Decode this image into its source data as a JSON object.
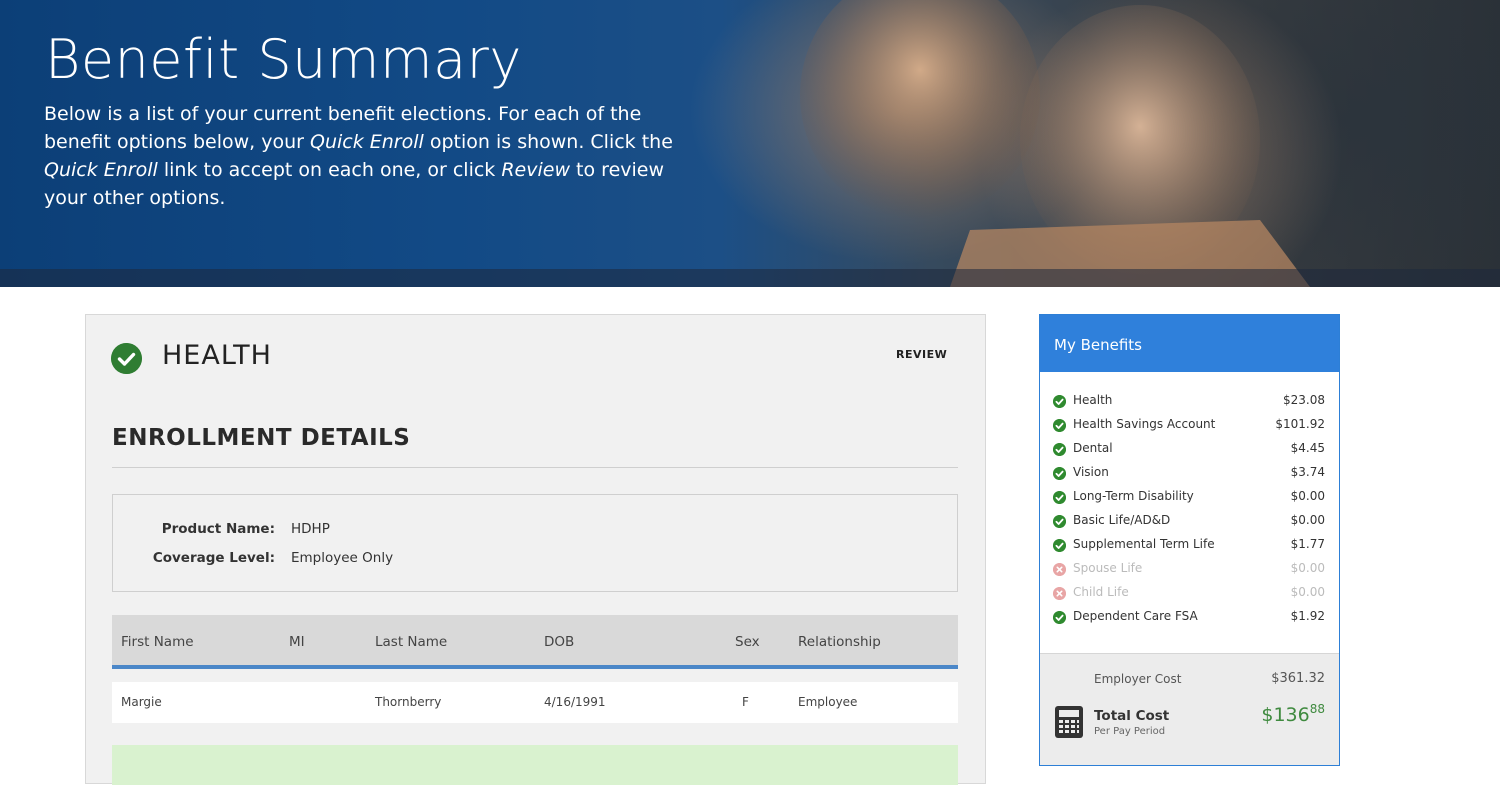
{
  "hero": {
    "title": "Benefit Summary",
    "desc_1": "Below is a list of your current benefit elections. For each of the benefit options below, your ",
    "desc_quick_1": "Quick Enroll",
    "desc_2": " option is shown. Click the ",
    "desc_quick_2": "Quick Enroll",
    "desc_3": " link to accept on each one, or click ",
    "desc_review": "Review",
    "desc_4": " to review your other options."
  },
  "card": {
    "section_title": "HEALTH",
    "review_label": "REVIEW",
    "enroll_title": "ENROLLMENT DETAILS",
    "product_label": "Product Name:",
    "product_value": "HDHP",
    "coverage_label": "Coverage Level:",
    "coverage_value": "Employee Only",
    "columns": [
      "First Name",
      "MI",
      "Last Name",
      "DOB",
      "Sex",
      "Relationship"
    ],
    "rows": [
      {
        "first": "Margie",
        "mi": "",
        "last": "Thornberry",
        "dob": "4/16/1991",
        "sex": "F",
        "rel": "Employee"
      }
    ]
  },
  "sidebar": {
    "title": "My Benefits",
    "items": [
      {
        "name": "Health",
        "amount": "$23.08",
        "status": "enrolled"
      },
      {
        "name": "Health Savings Account",
        "amount": "$101.92",
        "status": "enrolled"
      },
      {
        "name": "Dental",
        "amount": "$4.45",
        "status": "enrolled"
      },
      {
        "name": "Vision",
        "amount": "$3.74",
        "status": "enrolled"
      },
      {
        "name": "Long-Term Disability",
        "amount": "$0.00",
        "status": "enrolled"
      },
      {
        "name": "Basic Life/AD&D",
        "amount": "$0.00",
        "status": "enrolled"
      },
      {
        "name": "Supplemental Term Life",
        "amount": "$1.77",
        "status": "enrolled"
      },
      {
        "name": "Spouse Life",
        "amount": "$0.00",
        "status": "waived"
      },
      {
        "name": "Child Life",
        "amount": "$0.00",
        "status": "waived"
      },
      {
        "name": "Dependent Care FSA",
        "amount": "$1.92",
        "status": "enrolled"
      }
    ],
    "employer_cost_label": "Employer Cost",
    "employer_cost_value": "$361.32",
    "total_cost_label": "Total Cost",
    "total_cost_sub": "Per Pay Period",
    "total_dollars": "$136",
    "total_cents": "88"
  },
  "colors": {
    "accent": "#2f80db",
    "enrolled": "#2f8a2f",
    "waived": "#e8a5a5",
    "total": "#3f8a3f"
  },
  "icons": {
    "section_status": "check-circle-icon",
    "enrolled": "check-circle-icon",
    "waived": "x-circle-icon",
    "total_cost": "calculator-icon"
  }
}
